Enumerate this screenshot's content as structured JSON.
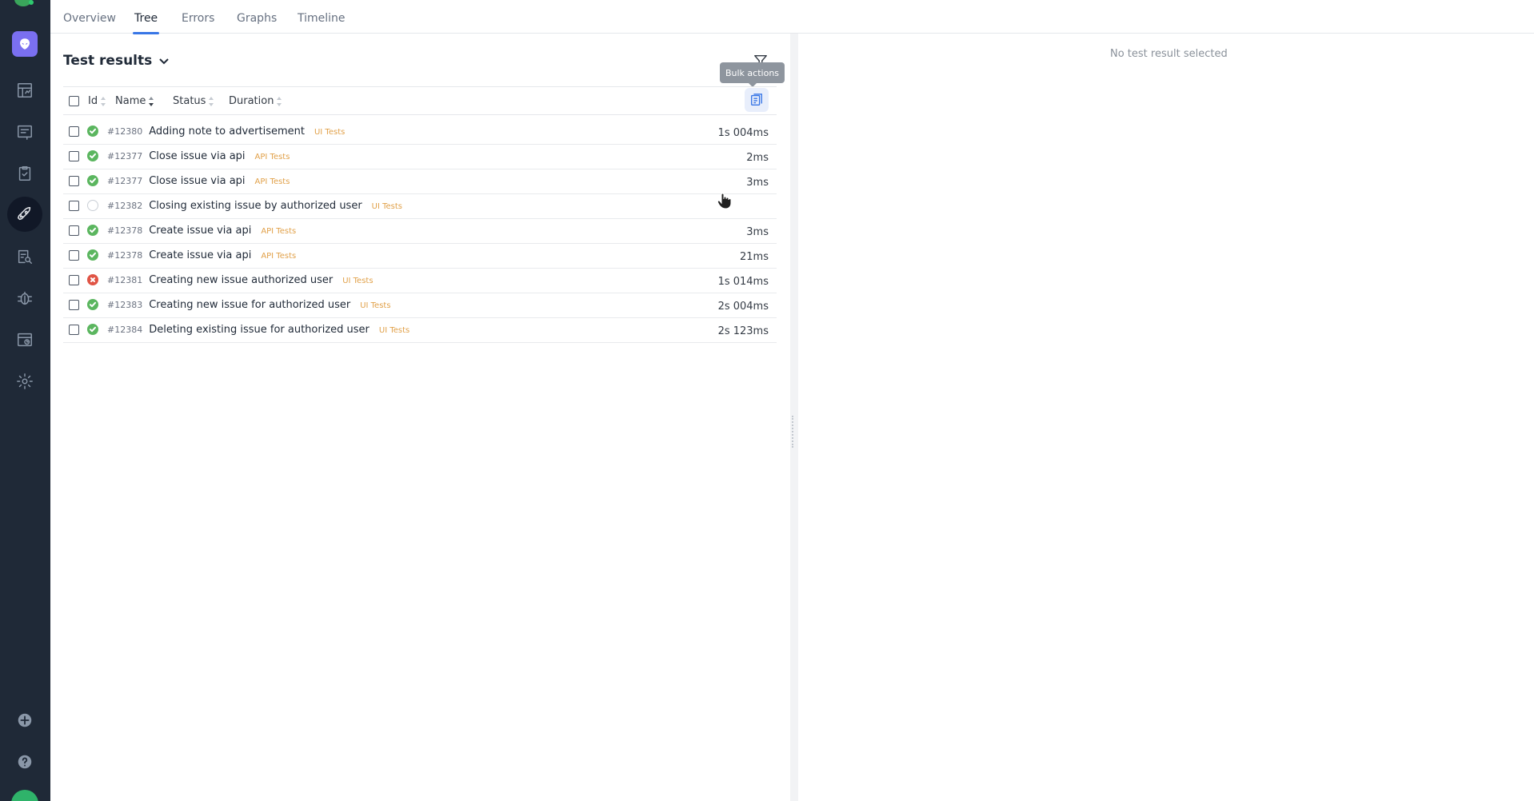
{
  "tabs": [
    {
      "label": "Overview"
    },
    {
      "label": "Tree"
    },
    {
      "label": "Errors"
    },
    {
      "label": "Graphs"
    },
    {
      "label": "Timeline"
    }
  ],
  "active_tab": "Tree",
  "results": {
    "title": "Test results",
    "tooltip": "Bulk actions",
    "columns": {
      "id": "Id",
      "name": "Name",
      "status": "Status",
      "duration": "Duration"
    },
    "rows": [
      {
        "id": "#12380",
        "name": "Adding note to advertisement",
        "tag": "UI Tests",
        "duration": "1s 004ms",
        "status": "passed"
      },
      {
        "id": "#12377",
        "name": "Close issue via api",
        "tag": "API Tests",
        "duration": "2ms",
        "status": "passed"
      },
      {
        "id": "#12377",
        "name": "Close issue via api",
        "tag": "API Tests",
        "duration": "3ms",
        "status": "passed"
      },
      {
        "id": "#12382",
        "name": "Closing existing issue by authorized user",
        "tag": "UI Tests",
        "duration": "",
        "status": "unknown"
      },
      {
        "id": "#12378",
        "name": "Create issue via api",
        "tag": "API Tests",
        "duration": "3ms",
        "status": "passed"
      },
      {
        "id": "#12378",
        "name": "Create issue via api",
        "tag": "API Tests",
        "duration": "21ms",
        "status": "passed"
      },
      {
        "id": "#12381",
        "name": "Creating new issue authorized user",
        "tag": "UI Tests",
        "duration": "1s 014ms",
        "status": "failed"
      },
      {
        "id": "#12383",
        "name": "Creating new issue for authorized user",
        "tag": "UI Tests",
        "duration": "2s 004ms",
        "status": "passed"
      },
      {
        "id": "#12384",
        "name": "Deleting existing issue for authorized user",
        "tag": "UI Tests",
        "duration": "2s 123ms",
        "status": "passed"
      }
    ]
  },
  "details": {
    "empty_message": "No test result selected"
  },
  "colors": {
    "sidebar": "#1f2937",
    "accent": "#3876e6",
    "passed": "#5bb65f",
    "failed": "#e05445",
    "tag": "#e1a14a"
  }
}
